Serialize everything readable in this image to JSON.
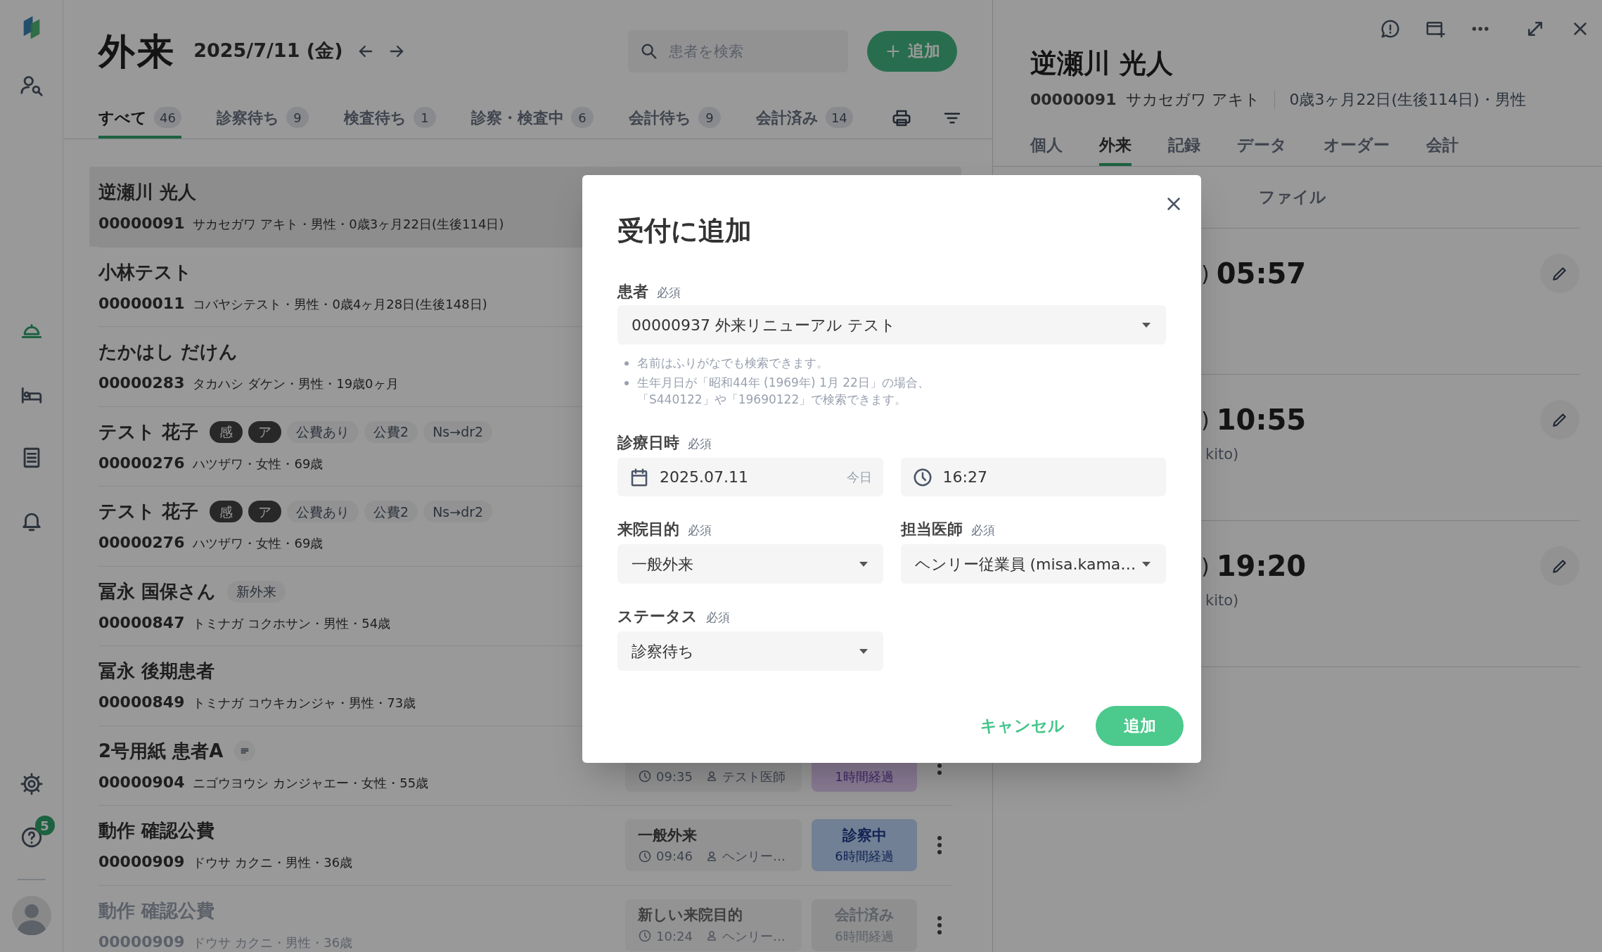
{
  "sidebar": {
    "nav_groups": [
      [
        {
          "kind": "patient-search",
          "selected": false
        }
      ],
      [
        {
          "kind": "reception",
          "selected": true
        },
        {
          "kind": "bed",
          "selected": false
        },
        {
          "kind": "records",
          "selected": false
        },
        {
          "kind": "notifications",
          "selected": false
        }
      ]
    ],
    "bottom": [
      {
        "kind": "settings"
      },
      {
        "kind": "help",
        "badge": "5"
      }
    ]
  },
  "header": {
    "title": "外来",
    "date": "2025/7/11 (金)",
    "search": {
      "placeholder": "患者を検索"
    },
    "add_button": "追加"
  },
  "tabs": [
    {
      "label": "すべて",
      "count": "46",
      "selected": true
    },
    {
      "label": "診察待ち",
      "count": "9",
      "selected": false
    },
    {
      "label": "検査待ち",
      "count": "1",
      "selected": false
    },
    {
      "label": "診察・検査中",
      "count": "6",
      "selected": false
    },
    {
      "label": "会計待ち",
      "count": "9",
      "selected": false
    },
    {
      "label": "会計済み",
      "count": "14",
      "selected": false
    }
  ],
  "patients": [
    {
      "name": "逆瀬川 光人",
      "id": "00000091",
      "detail": "サカセガワ アキト・男性・0歳3ヶ月22日(生後114日)",
      "selected": true,
      "faded": false
    },
    {
      "name": "小林テスト",
      "id": "00000011",
      "detail": "コバヤシテスト・男性・0歳4ヶ月28日(生後148日)",
      "selected": false,
      "faded": false
    },
    {
      "name": "たかはし だけん",
      "id": "00000283",
      "detail": "タカハシ ダケン・男性・19歳0ヶ月",
      "selected": false,
      "faded": false
    },
    {
      "name": "テスト 花子",
      "tags": [
        {
          "kind": "dark",
          "label": "感"
        },
        {
          "kind": "dark",
          "label": "ア"
        },
        {
          "kind": "light",
          "label": "公費あり"
        },
        {
          "kind": "light",
          "label": "公費2"
        },
        {
          "kind": "light",
          "label": "Ns→dr2"
        }
      ],
      "id": "00000276",
      "detail": "ハツザワ・女性・69歳",
      "selected": false,
      "faded": false
    },
    {
      "name": "テスト 花子",
      "tags": [
        {
          "kind": "dark",
          "label": "感"
        },
        {
          "kind": "dark",
          "label": "ア"
        },
        {
          "kind": "light",
          "label": "公費あり"
        },
        {
          "kind": "light",
          "label": "公費2"
        },
        {
          "kind": "light",
          "label": "Ns→dr2"
        }
      ],
      "id": "00000276",
      "detail": "ハツザワ・女性・69歳",
      "selected": false,
      "faded": false
    },
    {
      "name": "冨永 国保さん",
      "tags": [
        {
          "kind": "light",
          "label": "新外来"
        }
      ],
      "id": "00000847",
      "detail": "トミナガ コクホサン・男性・54歳",
      "selected": false,
      "faded": false
    },
    {
      "name": "冨永 後期患者",
      "id": "00000849",
      "detail": "トミナガ コウキカンジャ・男性・73歳",
      "selected": false,
      "faded": false
    },
    {
      "name": "2号用紙 患者A",
      "tags": [
        {
          "kind": "note"
        }
      ],
      "id": "00000904",
      "detail": "ニゴウヨウシ カンジャエー・女性・55歳",
      "selected": false,
      "faded": false,
      "visit": {
        "time": "09:35",
        "doctor": "テスト医師"
      },
      "status": {
        "kind": "waiting",
        "elapsed": "1時間経過"
      }
    },
    {
      "name": "動作 確認公費",
      "id": "00000909",
      "detail": "ドウサ カクニ・男性・36歳",
      "selected": false,
      "faded": false,
      "visit": {
        "purpose": "一般外来",
        "time": "09:46",
        "doctor": "ヘンリー…"
      },
      "status": {
        "kind": "in-exam",
        "label": "診察中",
        "elapsed": "6時間経過"
      }
    },
    {
      "name": "動作 確認公費",
      "id": "00000909",
      "detail": "ドウサ カクニ・男性・36歳",
      "selected": false,
      "faded": true,
      "visit": {
        "purpose": "新しい来院目的",
        "time": "10:24",
        "doctor": "ヘンリー…"
      },
      "status": {
        "kind": "paid",
        "label": "会計済み",
        "elapsed": "6時間経過"
      }
    }
  ],
  "detail_panel": {
    "name": "逆瀬川 光人",
    "id": "00000091",
    "kana": "サカセガワ アキト",
    "age_sex": "0歳3ヶ月22日(生後114日)・男性",
    "tabs": [
      {
        "label": "個人",
        "selected": false
      },
      {
        "label": "外来",
        "selected": true
      },
      {
        "label": "記録",
        "selected": false
      },
      {
        "label": "データ",
        "selected": false
      },
      {
        "label": "オーダー",
        "selected": false
      },
      {
        "label": "会計",
        "selected": false
      }
    ],
    "subtab": "ファイル",
    "entries": [
      {
        "prefix": ")",
        "time": "05:57"
      },
      {
        "prefix": ")",
        "time": "10:55",
        "note": "kito)"
      },
      {
        "prefix": ")",
        "time": "19:20",
        "note": "kito)"
      }
    ]
  },
  "modal": {
    "title": "受付に追加",
    "patient": {
      "label": "患者",
      "required": "必須",
      "value": "00000937 外来リニューアル テスト"
    },
    "hints": [
      "名前はふりがなでも検索できます。",
      "生年月日が「昭和44年 (1969年) 1月 22日」の場合、「S440122」や「19690122」で検索できます。"
    ],
    "datetime": {
      "label": "診療日時",
      "required": "必須",
      "date": "2025.07.11",
      "date_suffix": "今日",
      "time": "16:27"
    },
    "purpose": {
      "label": "来院目的",
      "required": "必須",
      "value": "一般外来"
    },
    "doctor": {
      "label": "担当医師",
      "required": "必須",
      "value": "ヘンリー従業員 (misa.kama…"
    },
    "status": {
      "label": "ステータス",
      "required": "必須",
      "value": "診察待ち"
    },
    "cancel_button": "キャンセル",
    "submit_button": "追加"
  }
}
